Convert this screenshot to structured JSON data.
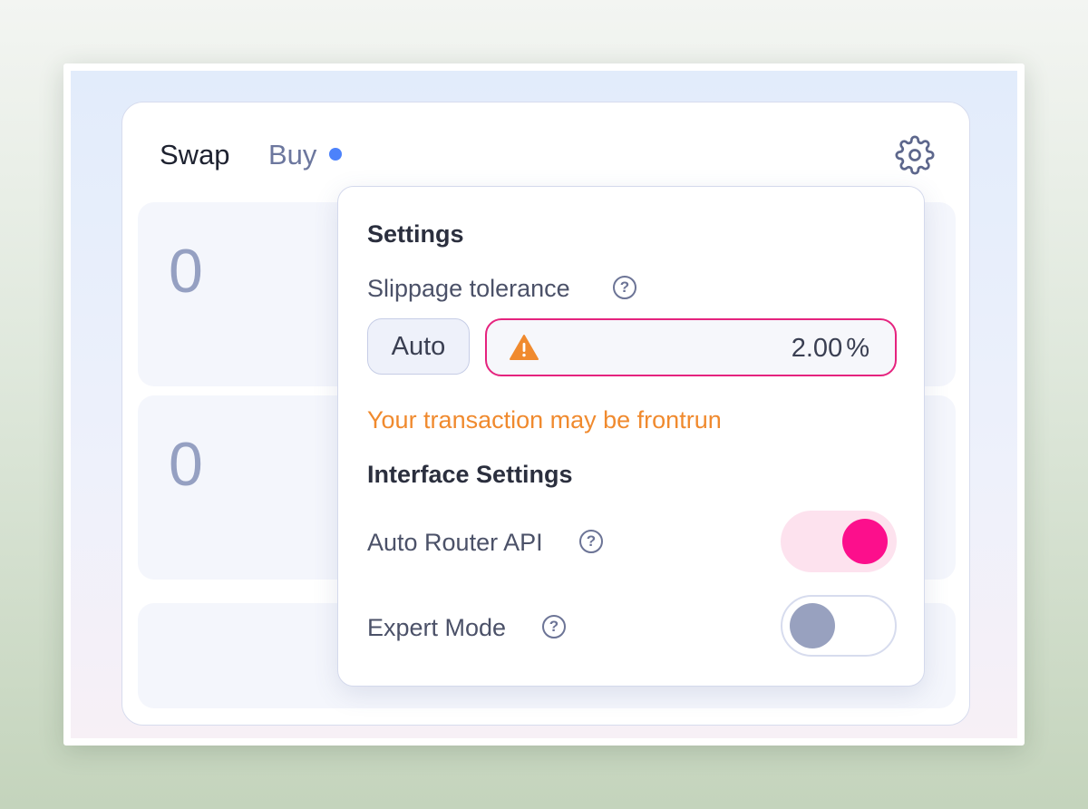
{
  "tabs": {
    "swap_label": "Swap",
    "buy_label": "Buy"
  },
  "inputs": {
    "sell_amount": "0",
    "buy_amount": "0"
  },
  "icons": {
    "settings": "gear-icon",
    "help": "question-circle-icon",
    "warning": "warning-triangle-icon"
  },
  "settings": {
    "title": "Settings",
    "slippage_label": "Slippage tolerance",
    "help_glyph": "?",
    "auto_label": "Auto",
    "slippage_value": "2.00",
    "slippage_unit": "%",
    "warning": "Your transaction may be frontrun",
    "interface_title": "Interface Settings",
    "auto_router_label": "Auto Router API",
    "auto_router_enabled": true,
    "expert_mode_label": "Expert Mode",
    "expert_mode_enabled": false
  },
  "colors": {
    "accent_pink": "#fc0f8c",
    "warning_orange": "#f08a2e",
    "notification_dot": "#4c82fb"
  }
}
